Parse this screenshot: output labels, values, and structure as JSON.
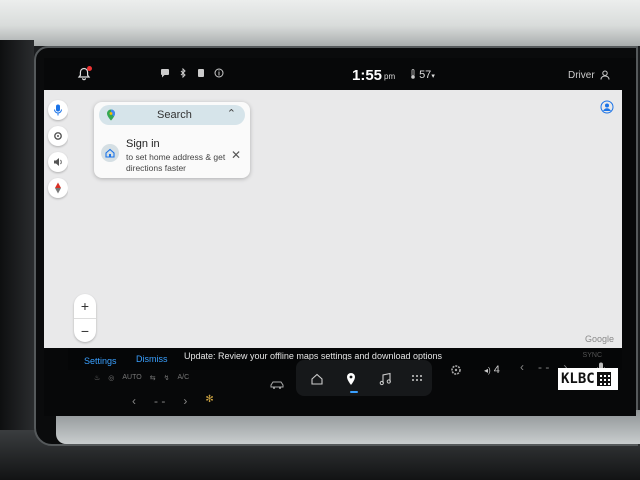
{
  "status_bar": {
    "time": "1:55",
    "ampm": "pm",
    "temperature": "57",
    "driver_label": "Driver"
  },
  "search_card": {
    "search_label": "Search",
    "signin_title": "Sign in",
    "signin_description": "to set home address & get directions faster",
    "close_glyph": "✕",
    "chevron_glyph": "⌃"
  },
  "map": {
    "attribution": "Google",
    "zoom_in": "+",
    "zoom_out": "−"
  },
  "banner": {
    "settings_label": "Settings",
    "dismiss_label": "Dismiss",
    "message": "Update: Review your offline maps settings and download options",
    "sync_label": "SYNC"
  },
  "bottom_bar": {
    "auto_label": "AUTO",
    "ac_label": "A/C",
    "left_temp": "- -",
    "right_temp": "- -",
    "volume_level": "4"
  },
  "watermark": {
    "text": "KLBC"
  },
  "colors": {
    "accent": "#3aa0ff",
    "map_background": "#e9e9ea",
    "search_bar": "#d6e4ea",
    "notification_dot": "#e33333"
  }
}
